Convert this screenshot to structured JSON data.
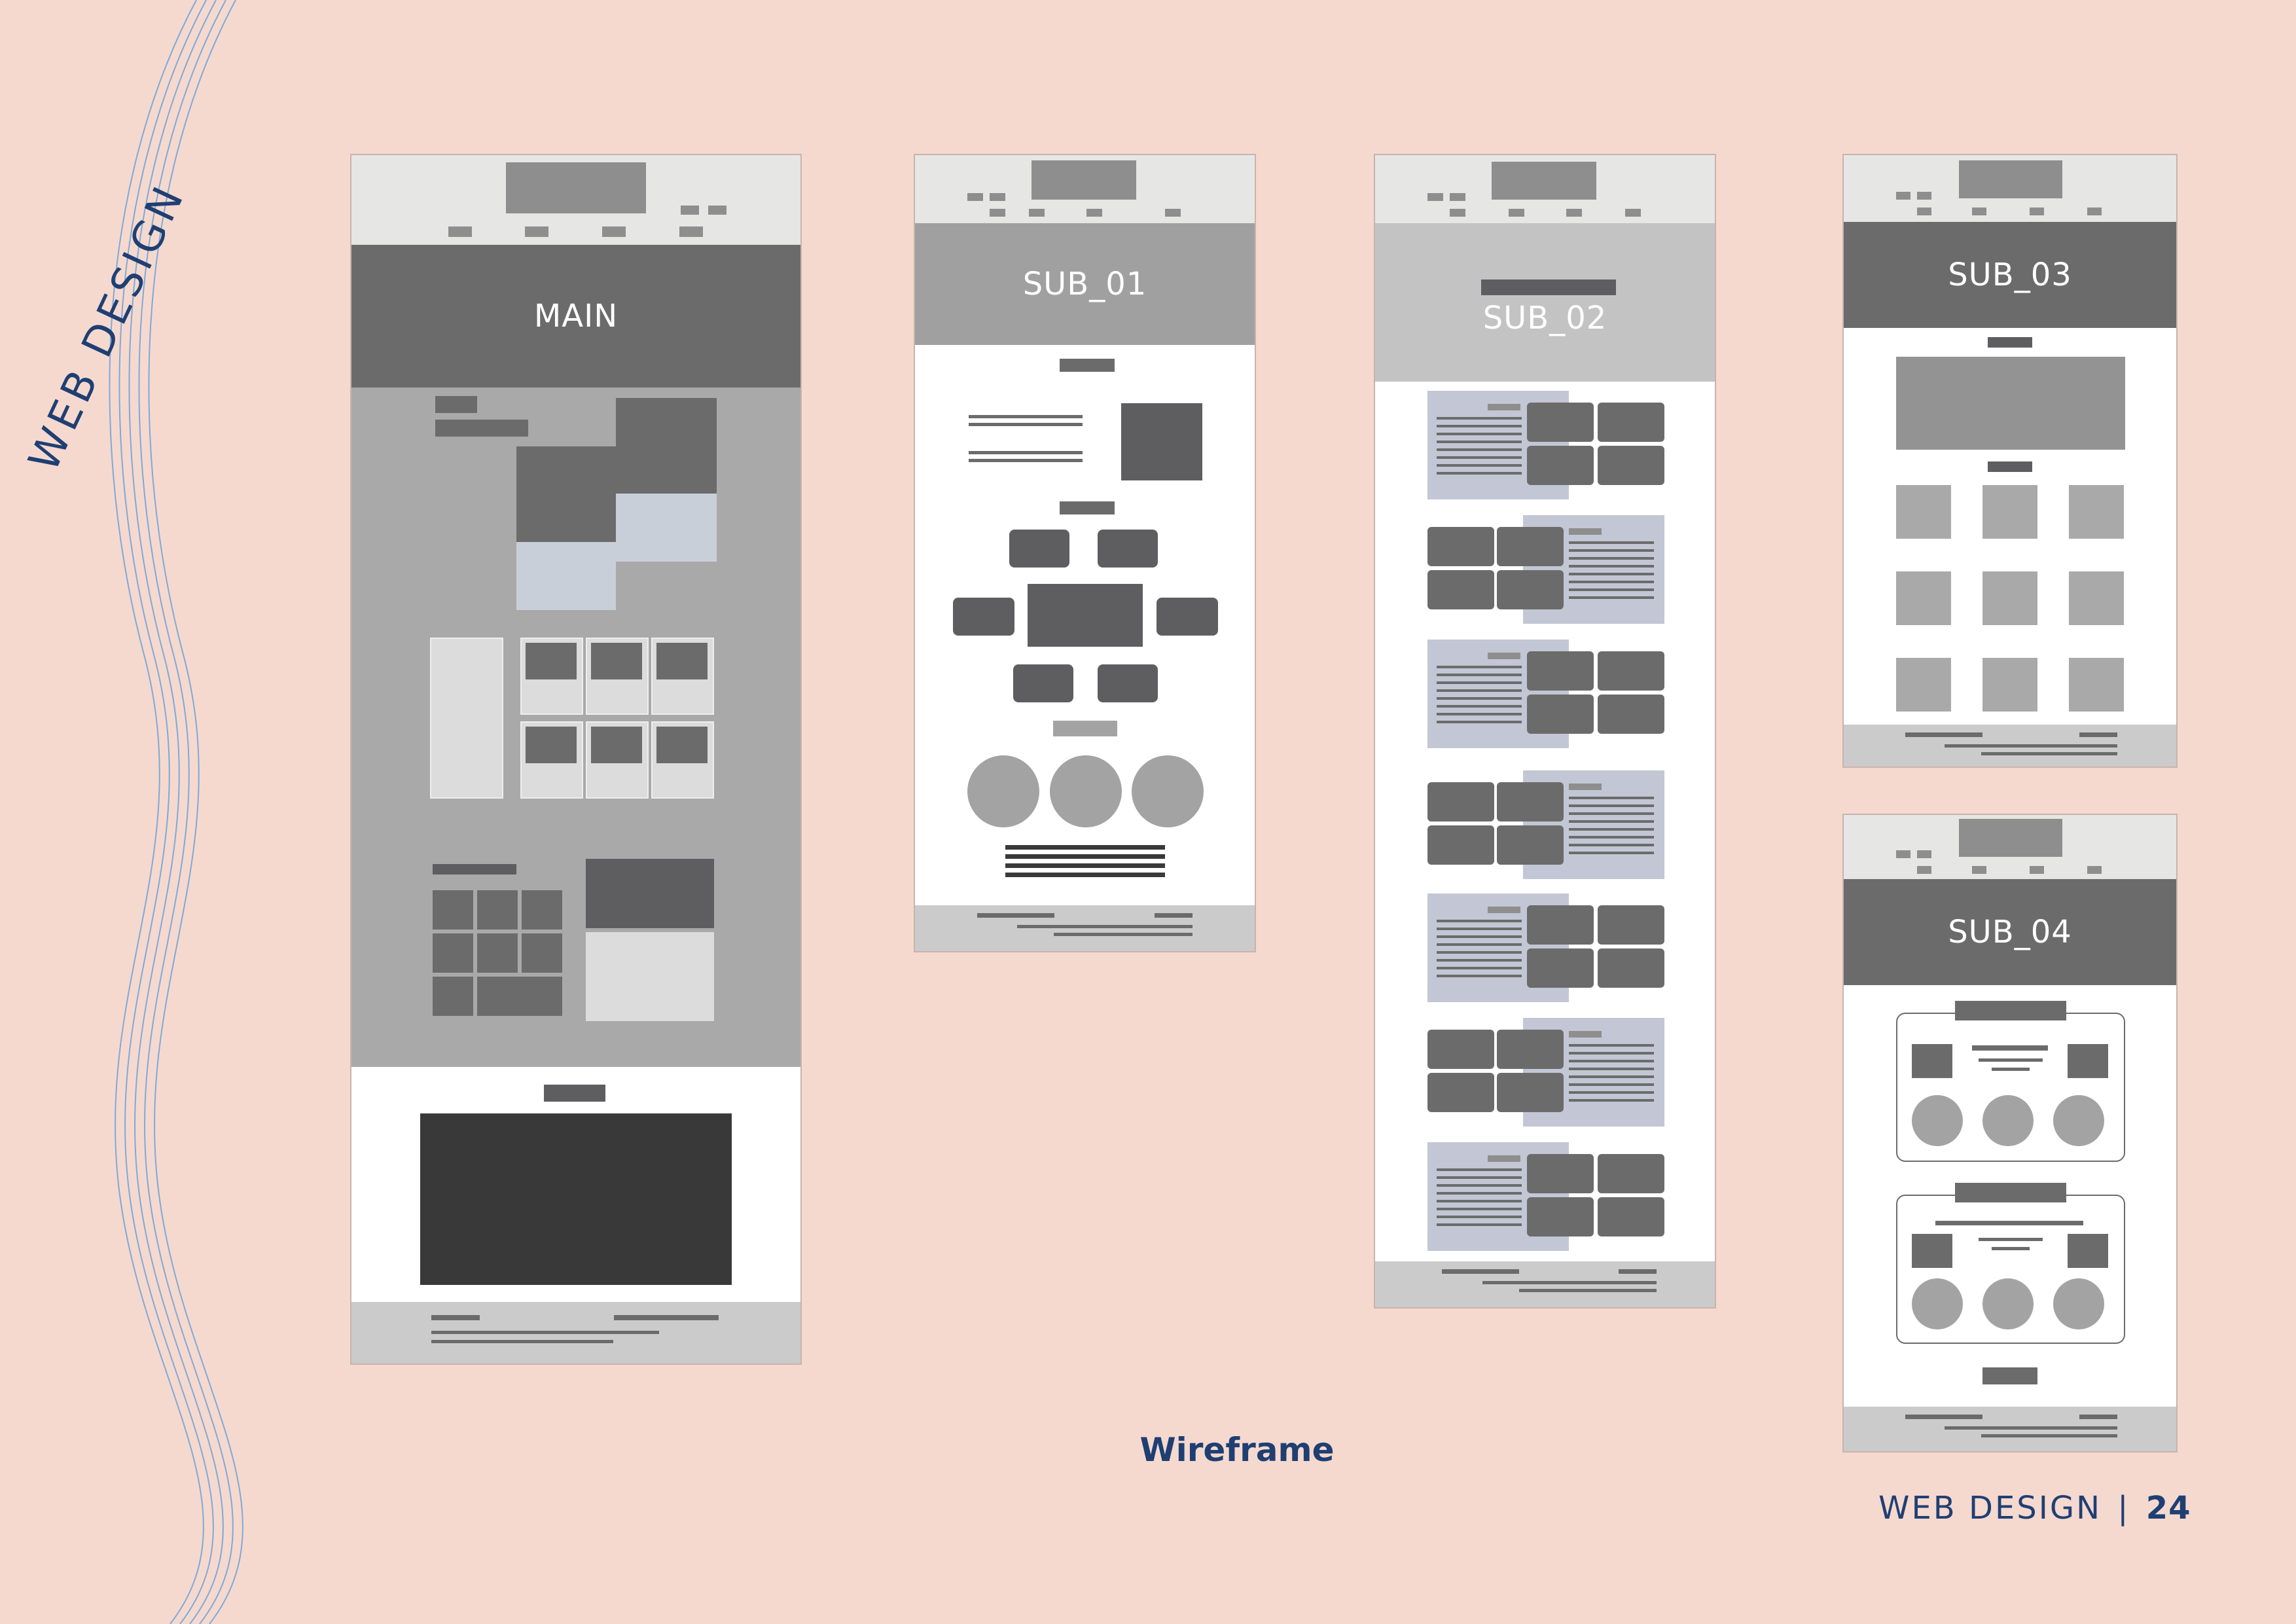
{
  "side_title": "WEB DESIGN",
  "caption": "Wireframe",
  "footer": {
    "section": "WEB DESIGN",
    "separator": "|",
    "page_number": "24"
  },
  "wireframes": {
    "main": "MAIN",
    "sub1": "SUB_01",
    "sub2": "SUB_02",
    "sub3": "SUB_03",
    "sub4": "SUB_04"
  },
  "colors": {
    "background": "#f5d9cf",
    "accent": "#1f3f73",
    "wave": "#7fa9d8"
  }
}
